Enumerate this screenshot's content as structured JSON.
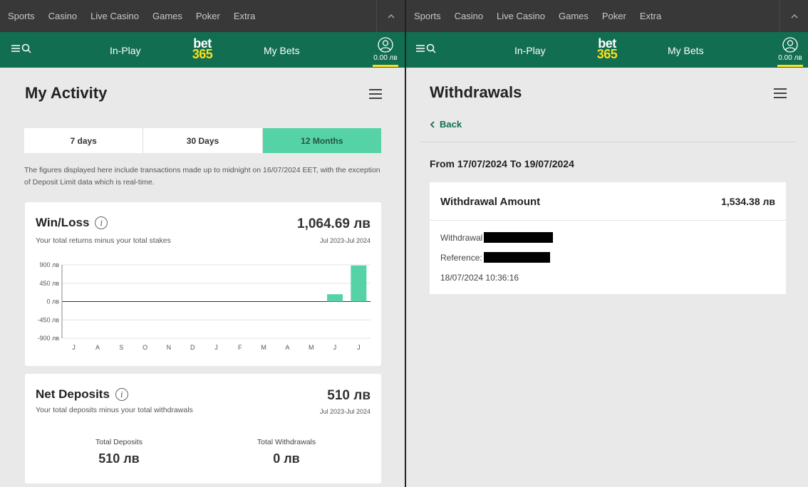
{
  "top_nav": {
    "items": [
      "Sports",
      "Casino",
      "Live Casino",
      "Games",
      "Poker",
      "Extra"
    ]
  },
  "header": {
    "in_play": "In-Play",
    "logo_top": "bet",
    "logo_bottom": "365",
    "my_bets": "My Bets",
    "balance": "0.00 лв"
  },
  "activity": {
    "title": "My Activity",
    "tabs": [
      {
        "label": "7 days",
        "active": false
      },
      {
        "label": "30 Days",
        "active": false
      },
      {
        "label": "12 Months",
        "active": true
      }
    ],
    "disclaimer": "The figures displayed here include transactions made up to midnight on 16/07/2024 EET, with the exception of Deposit Limit data which is real-time.",
    "win_loss": {
      "title": "Win/Loss",
      "subtitle": "Your total returns minus your total stakes",
      "value": "1,064.69 лв",
      "period": "Jul 2023-Jul 2024"
    },
    "net_deposits": {
      "title": "Net Deposits",
      "subtitle": "Your total deposits minus your total withdrawals",
      "value": "510 лв",
      "period": "Jul 2023-Jul 2024",
      "total_deposits_label": "Total Deposits",
      "total_deposits_value": "510 лв",
      "total_withdrawals_label": "Total Withdrawals",
      "total_withdrawals_value": "0 лв"
    }
  },
  "chart_data": {
    "type": "bar",
    "categories": [
      "J",
      "A",
      "S",
      "O",
      "N",
      "D",
      "J",
      "F",
      "M",
      "A",
      "M",
      "J",
      "J"
    ],
    "values": [
      0,
      0,
      0,
      0,
      0,
      0,
      0,
      0,
      0,
      0,
      0,
      180,
      885
    ],
    "ylim": [
      -900,
      900
    ],
    "yticks": [
      900,
      450,
      0,
      -450,
      -900
    ],
    "ytick_labels": [
      "900 лв",
      "450 лв",
      "0 лв",
      "-450 лв",
      "-900 лв"
    ],
    "bar_color": "#56d3a6",
    "grid": true
  },
  "withdrawals": {
    "title": "Withdrawals",
    "back": "Back",
    "date_range": "From 17/07/2024 To 19/07/2024",
    "card_title": "Withdrawal Amount",
    "amount": "1,534.38 лв",
    "withdrawal_label": "Withdrawal",
    "reference_label": "Reference:",
    "timestamp": "18/07/2024 10:36:16"
  },
  "colors": {
    "brand_green": "#126e51",
    "accent_mint": "#56d3a6",
    "accent_yellow": "#ffdf1b"
  }
}
